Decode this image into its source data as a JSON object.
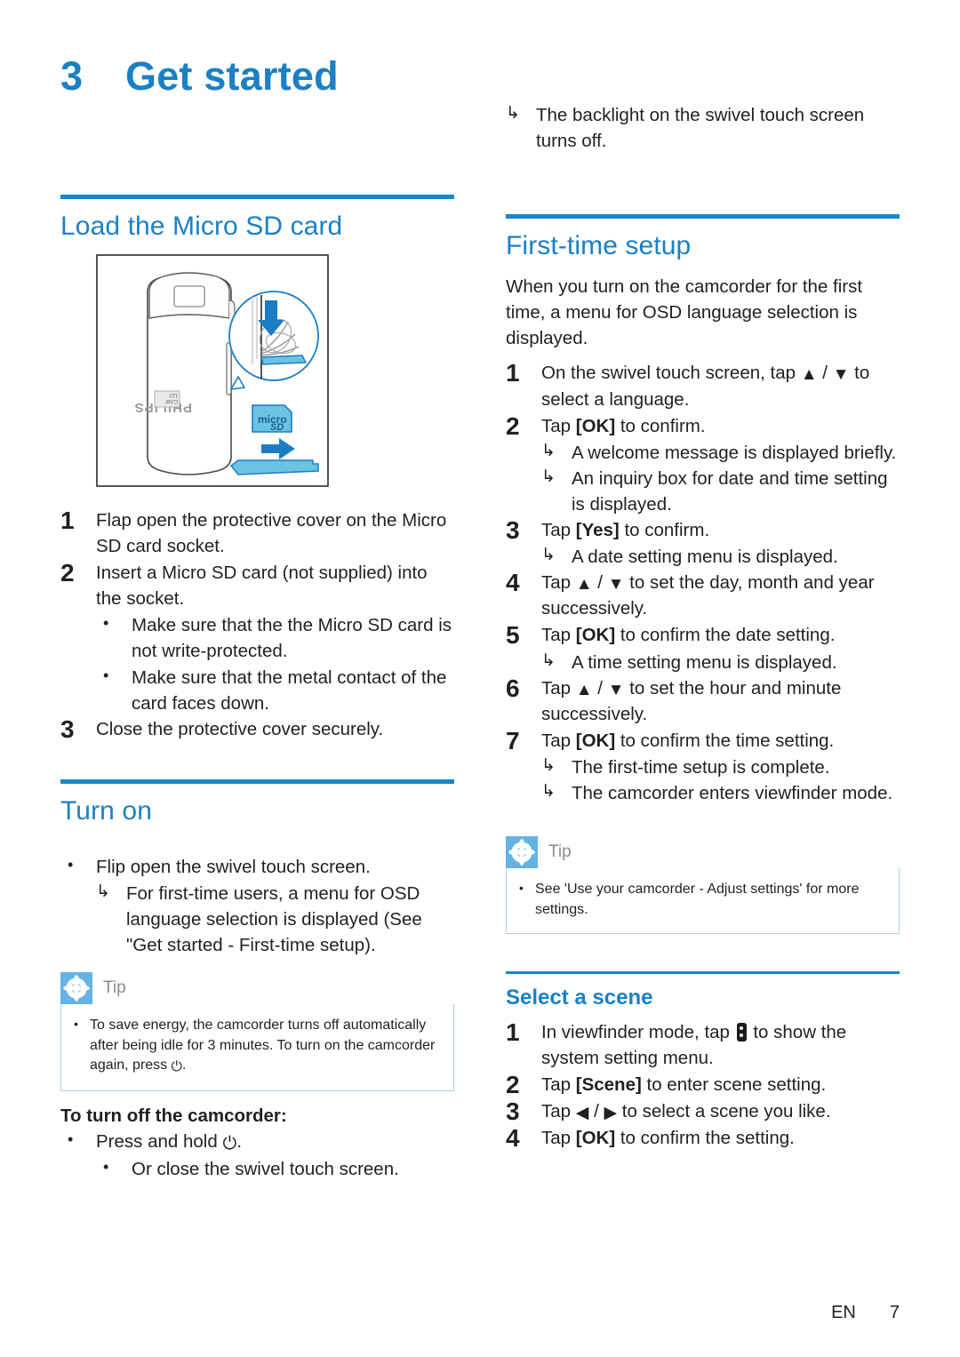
{
  "chapter": {
    "number": "3",
    "title": "Get started"
  },
  "left_column": {
    "section_load": {
      "heading": "Load the Micro SD card",
      "figure": {
        "name": "micro-sd-insertion-illustration",
        "brand_text": "PHILIPS",
        "card_label": "micro",
        "card_sublabel": "SD"
      },
      "steps": [
        {
          "num": "1",
          "text": "Flap open the protective cover on the Micro SD card socket."
        },
        {
          "num": "2",
          "text": "Insert a Micro SD card (not supplied) into the socket."
        }
      ],
      "step2_bullets": [
        "Make sure that the the Micro SD card is not write-protected.",
        "Make sure that the metal contact of the card faces down."
      ],
      "step3": {
        "num": "3",
        "text": "Close the protective cover securely."
      }
    },
    "section_turn_on": {
      "heading": "Turn on",
      "bullet": "Flip open the swivel touch screen.",
      "result": "For first-time users, a menu for OSD language selection is displayed (See \"Get started - First-time setup)."
    },
    "tip": {
      "label": "Tip",
      "icon": "asterisk-icon",
      "text_before_symbol": "To save energy, the camcorder turns off automatically after being idle for 3 minutes. To turn on the camcorder again, press ",
      "symbol": "⏻",
      "text_after_symbol": "."
    },
    "turn_off": {
      "heading": "To turn off the camcorder:",
      "bullet_before_symbol": "Press and hold ",
      "bullet_symbol": "⏻",
      "bullet_after_symbol": ".",
      "sub_bullet": "Or close the swivel touch screen."
    }
  },
  "right_column": {
    "top_result": "The backlight on the swivel touch screen turns off.",
    "section_first_time": {
      "heading": "First-time setup",
      "intro": "When you turn on the camcorder for the first time, a menu for OSD language selection is displayed.",
      "steps": [
        {
          "num": "1",
          "pre": "On the swivel touch screen, tap ",
          "glyph_up": "▲",
          "sep": " / ",
          "glyph_down": "▼",
          "post": " to select a language.",
          "results": []
        },
        {
          "num": "2",
          "pre": "Tap ",
          "bold": "[OK]",
          "post": " to confirm.",
          "results": [
            "A welcome message is displayed briefly.",
            "An inquiry box for date and time setting is displayed."
          ]
        },
        {
          "num": "3",
          "pre": "Tap ",
          "bold": "[Yes]",
          "post": " to confirm.",
          "results": [
            "A date setting menu is displayed."
          ]
        },
        {
          "num": "4",
          "pre": "Tap ",
          "glyph_up": "▲",
          "sep": " / ",
          "glyph_down": "▼",
          "post": " to set the day, month and year successively.",
          "results": []
        },
        {
          "num": "5",
          "pre": "Tap ",
          "bold": "[OK]",
          "post": " to confirm the date setting.",
          "results": [
            "A time setting menu is displayed."
          ]
        },
        {
          "num": "6",
          "pre": "Tap ",
          "glyph_up": "▲",
          "sep": " / ",
          "glyph_down": "▼",
          "post": " to set the hour and minute successively.",
          "results": []
        },
        {
          "num": "7",
          "pre": "Tap ",
          "bold": "[OK]",
          "post": " to confirm the time setting.",
          "results": [
            "The first-time setup is complete.",
            "The camcorder enters viewfinder mode."
          ]
        }
      ]
    },
    "tip": {
      "label": "Tip",
      "icon": "asterisk-icon",
      "text": "See 'Use your camcorder - Adjust settings' for more settings."
    },
    "section_select_scene": {
      "heading": "Select a scene",
      "steps": [
        {
          "num": "1",
          "pre": "In viewfinder mode, tap ",
          "icon": "menu-button-icon",
          "post": " to show the system setting menu."
        },
        {
          "num": "2",
          "pre": "Tap ",
          "bold": "[Scene]",
          "post": " to enter scene setting."
        },
        {
          "num": "3",
          "pre": "Tap ",
          "glyph_left": "◀",
          "sep": " / ",
          "glyph_right": "▶",
          "post": " to select a scene you like."
        },
        {
          "num": "4",
          "pre": "Tap ",
          "bold": "[OK]",
          "post": " to confirm the setting."
        }
      ]
    }
  },
  "footer": {
    "language": "EN",
    "page_number": "7"
  },
  "colors": {
    "heading_blue": "#1b80c4",
    "rule_blue": "#1787c9",
    "tip_icon_blue": "#64b3e4",
    "tip_border_blue": "#a9cfe8",
    "body_text": "#231f20",
    "illustration_blue": "#1a7dc4",
    "illustration_fill": "#6cc3e0"
  }
}
